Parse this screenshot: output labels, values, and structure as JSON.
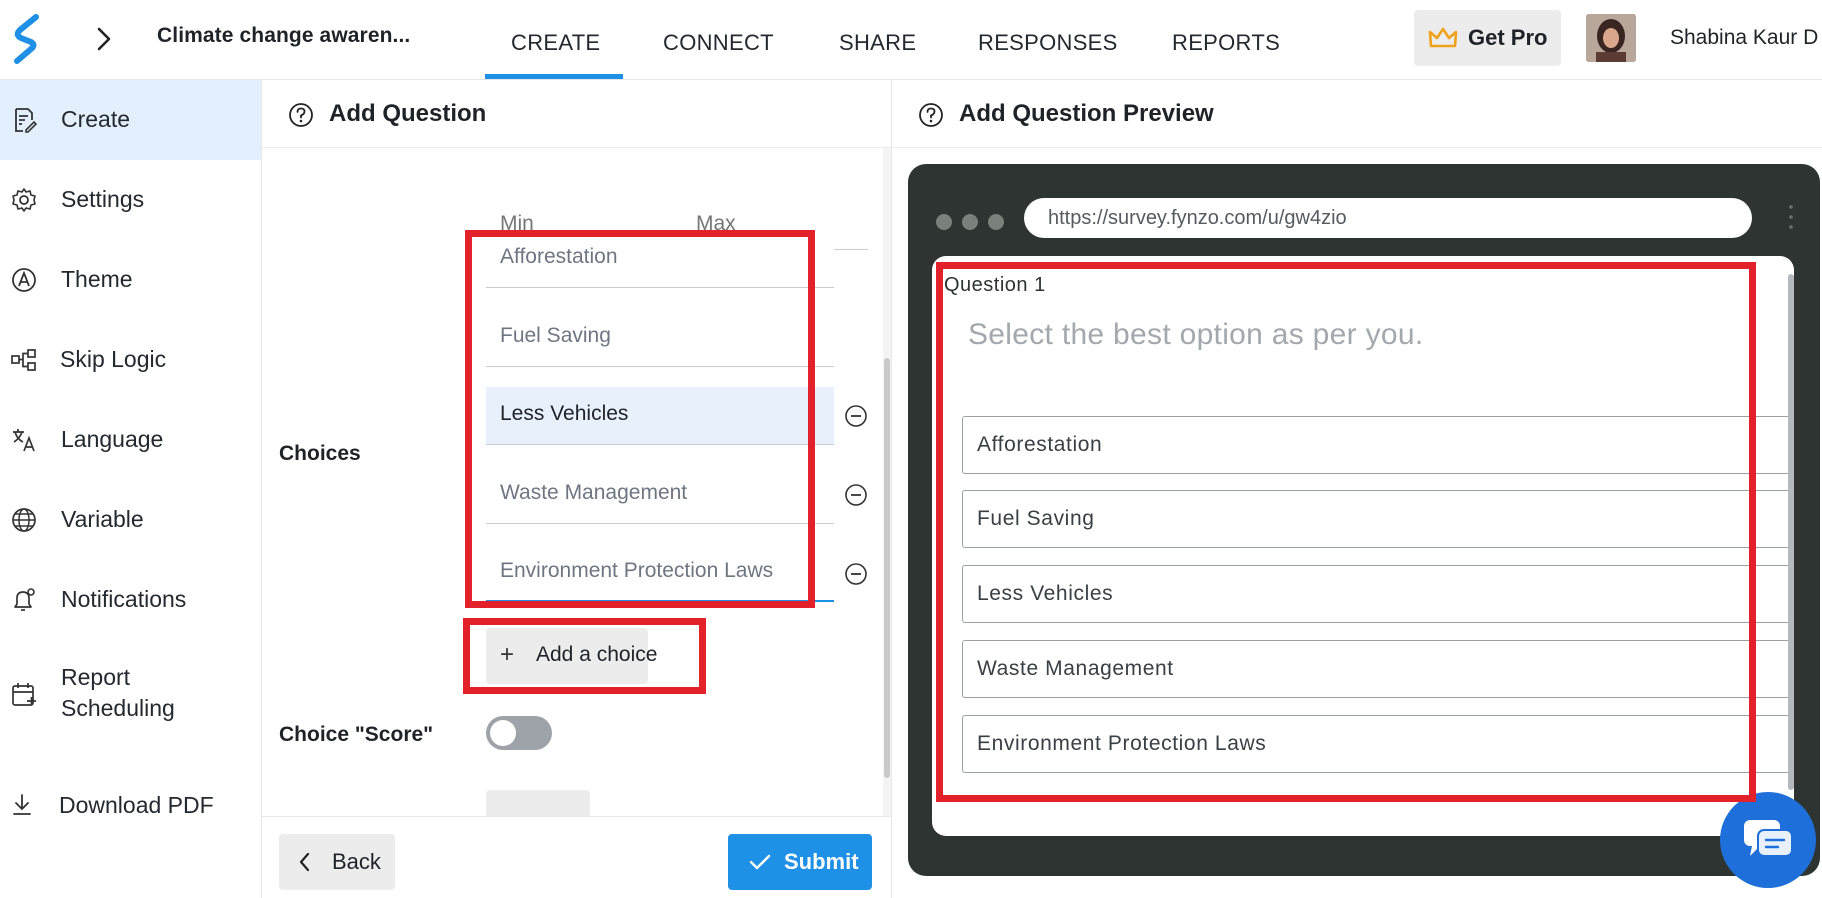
{
  "header": {
    "survey_title": "Climate change awaren...",
    "tabs": [
      {
        "label": "CREATE",
        "active": true
      },
      {
        "label": "CONNECT",
        "active": false
      },
      {
        "label": "SHARE",
        "active": false
      },
      {
        "label": "RESPONSES",
        "active": false
      },
      {
        "label": "REPORTS",
        "active": false
      }
    ],
    "get_pro_label": "Get Pro",
    "user_name": "Shabina Kaur D"
  },
  "sidebar": {
    "items": [
      {
        "label": "Create",
        "icon": "document-edit-icon",
        "active": true
      },
      {
        "label": "Settings",
        "icon": "gear-icon",
        "active": false
      },
      {
        "label": "Theme",
        "icon": "theme-icon",
        "active": false
      },
      {
        "label": "Skip Logic",
        "icon": "skip-logic-icon",
        "active": false
      },
      {
        "label": "Language",
        "icon": "translate-icon",
        "active": false
      },
      {
        "label": "Variable",
        "icon": "globe-icon",
        "active": false
      },
      {
        "label": "Notifications",
        "icon": "bell-icon",
        "active": false
      },
      {
        "label": "Report",
        "label2": "Scheduling",
        "icon": "calendar-icon",
        "active": false
      },
      {
        "label": "Download PDF",
        "icon": "download-icon",
        "active": false
      }
    ]
  },
  "editor": {
    "title": "Add Question",
    "min_placeholder": "Min",
    "max_placeholder": "Max",
    "choices_label": "Choices",
    "choices": [
      {
        "text": "Afforestation",
        "selected": false
      },
      {
        "text": "Fuel Saving",
        "selected": false
      },
      {
        "text": "Less Vehicles",
        "selected": true
      },
      {
        "text": "Waste Management",
        "selected": false
      },
      {
        "text": "Environment Protection Laws",
        "selected": false
      }
    ],
    "add_choice_label": "Add a choice",
    "score_label": "Choice \"Score\"",
    "score_enabled": false,
    "back_label": "Back",
    "submit_label": "Submit"
  },
  "preview": {
    "title": "Add Question Preview",
    "url": "https://survey.fynzo.com/u/gw4zio",
    "question_number": "Question 1",
    "question_text": "Select the best option as per you.",
    "options": [
      "Afforestation",
      "Fuel Saving",
      "Less Vehicles",
      "Waste Management",
      "Environment Protection Laws"
    ]
  },
  "colors": {
    "accent": "#1e90e6",
    "highlight": "#e3212b",
    "active_bg": "#e3effc",
    "browser_frame": "#2d3431"
  }
}
